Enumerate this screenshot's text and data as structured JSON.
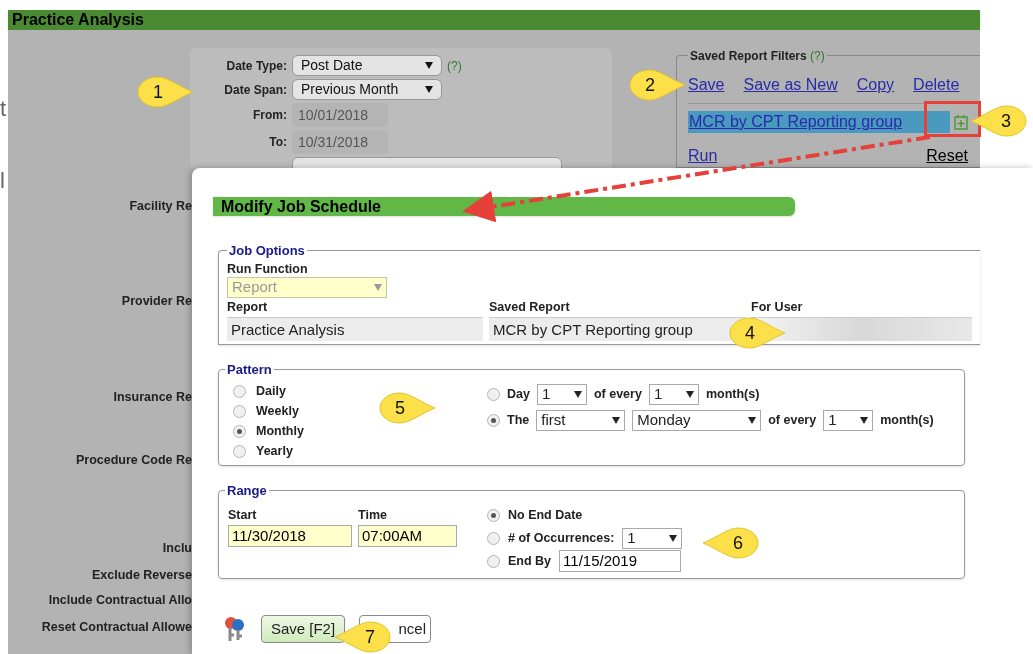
{
  "edge_letters": [
    "t",
    "l"
  ],
  "page": {
    "title": "Practice Analysis",
    "filters": [
      {
        "label": "Date Type:",
        "kind": "select",
        "value": "Post Date",
        "help": "(?)"
      },
      {
        "label": "Date Span:",
        "kind": "select",
        "value": "Previous Month"
      },
      {
        "label": "From:",
        "kind": "readonly",
        "value": "10/01/2018"
      },
      {
        "label": "To:",
        "kind": "readonly",
        "value": "10/31/2018"
      }
    ],
    "side_labels": [
      "Facility Re",
      "Provider Re",
      "Insurance Re",
      "Procedure Code Re",
      "Inclu",
      "Exclude Reverse",
      "Include Contractual Allo",
      "Reset Contractual Allowe"
    ],
    "saved_filters": {
      "legend": "Saved Report Filters",
      "help": "(?)",
      "actions": [
        "Save",
        "Save as New",
        "Copy",
        "Delete"
      ],
      "items": [
        {
          "label": "MCR by CPT Reporting group",
          "selected": true
        }
      ],
      "run": "Run",
      "reset": "Reset"
    }
  },
  "dialog": {
    "title": "Modify Job Schedule",
    "job_options": {
      "legend": "Job Options",
      "run_function_label": "Run Function",
      "run_function": {
        "value": "Report",
        "disabled": true
      },
      "columns": [
        {
          "heading": "Report",
          "value": "Practice Analysis"
        },
        {
          "heading": "Saved Report",
          "value": "MCR by CPT Reporting group"
        },
        {
          "heading": "For User",
          "kind": "blurred"
        }
      ]
    },
    "pattern": {
      "legend": "Pattern",
      "options": [
        {
          "label": "Daily",
          "selected": false
        },
        {
          "label": "Weekly",
          "selected": false
        },
        {
          "label": "Monthly",
          "selected": true
        },
        {
          "label": "Yearly",
          "selected": false
        }
      ],
      "monthly": [
        {
          "selected": false,
          "parts": [
            {
              "kind": "text",
              "text": "Day"
            },
            {
              "kind": "select",
              "value": "1"
            },
            {
              "kind": "text",
              "text": "of every"
            },
            {
              "kind": "select",
              "value": "1"
            },
            {
              "kind": "text",
              "text": "month(s)"
            }
          ]
        },
        {
          "selected": true,
          "parts": [
            {
              "kind": "text",
              "text": "The"
            },
            {
              "kind": "select",
              "value": "first"
            },
            {
              "kind": "select",
              "value": "Monday"
            },
            {
              "kind": "text",
              "text": "of every"
            },
            {
              "kind": "select",
              "value": "1"
            },
            {
              "kind": "text",
              "text": "month(s)"
            }
          ]
        }
      ]
    },
    "range": {
      "legend": "Range",
      "start_label": "Start",
      "start": "11/30/2018",
      "time_label": "Time",
      "time": "07:00AM",
      "end_options": [
        {
          "selected": true,
          "label": "No End Date"
        },
        {
          "selected": false,
          "label": "# of Occurrences:",
          "kind": "select",
          "value": "1"
        },
        {
          "selected": false,
          "label": "End By",
          "kind": "input",
          "value": "11/15/2019"
        }
      ]
    },
    "buttons": [
      {
        "label": "Save [F2]",
        "kind": "primary"
      },
      {
        "label": "ncel",
        "kind": "secondary"
      }
    ]
  },
  "callouts": [
    {
      "number": "1",
      "kind": "right"
    },
    {
      "number": "2",
      "kind": "right"
    },
    {
      "number": "3",
      "kind": "left"
    },
    {
      "number": "4",
      "kind": "right"
    },
    {
      "number": "5",
      "kind": "right"
    },
    {
      "number": "6",
      "kind": "left"
    },
    {
      "number": "7",
      "kind": "left"
    }
  ]
}
